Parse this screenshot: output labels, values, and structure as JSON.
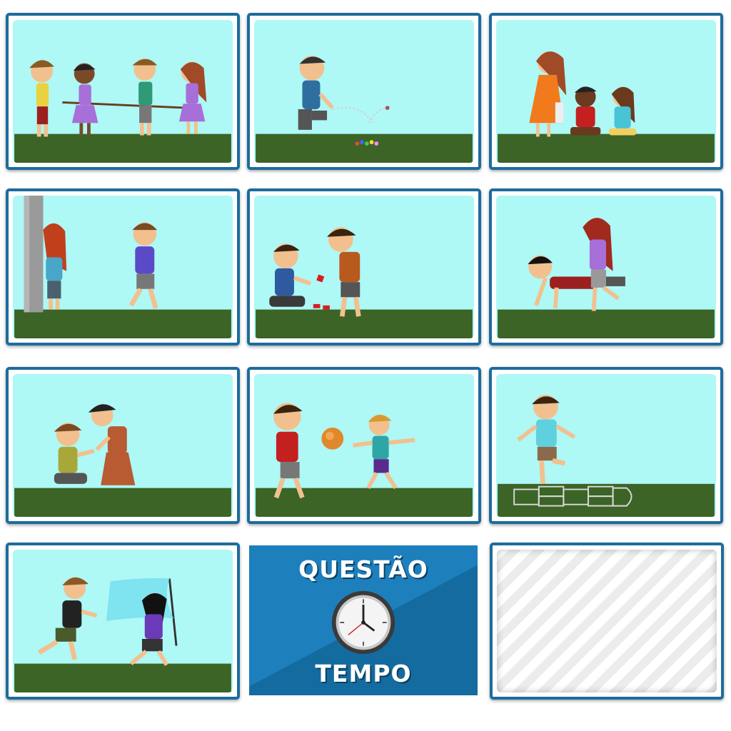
{
  "board": {
    "cards": [
      {
        "id": "tug-of-war"
      },
      {
        "id": "marbles"
      },
      {
        "id": "duck-duck-goose"
      },
      {
        "id": "hide-and-seek"
      },
      {
        "id": "jacks"
      },
      {
        "id": "wheelbarrow"
      },
      {
        "id": "clapping-game"
      },
      {
        "id": "dodgeball"
      },
      {
        "id": "hopscotch"
      },
      {
        "id": "capture-the-flag"
      }
    ],
    "blank_card": {
      "id": "empty-slot"
    }
  },
  "question_card": {
    "title": "QUESTÃO",
    "subtitle": "TEMPO",
    "icon": "clock-icon"
  },
  "colors": {
    "card_border": "#1c6c9e",
    "sky": "#aef8f6",
    "grass": "#3b6426",
    "question_bg_light": "#1d7fbc",
    "question_bg_dark": "#146b9f"
  }
}
